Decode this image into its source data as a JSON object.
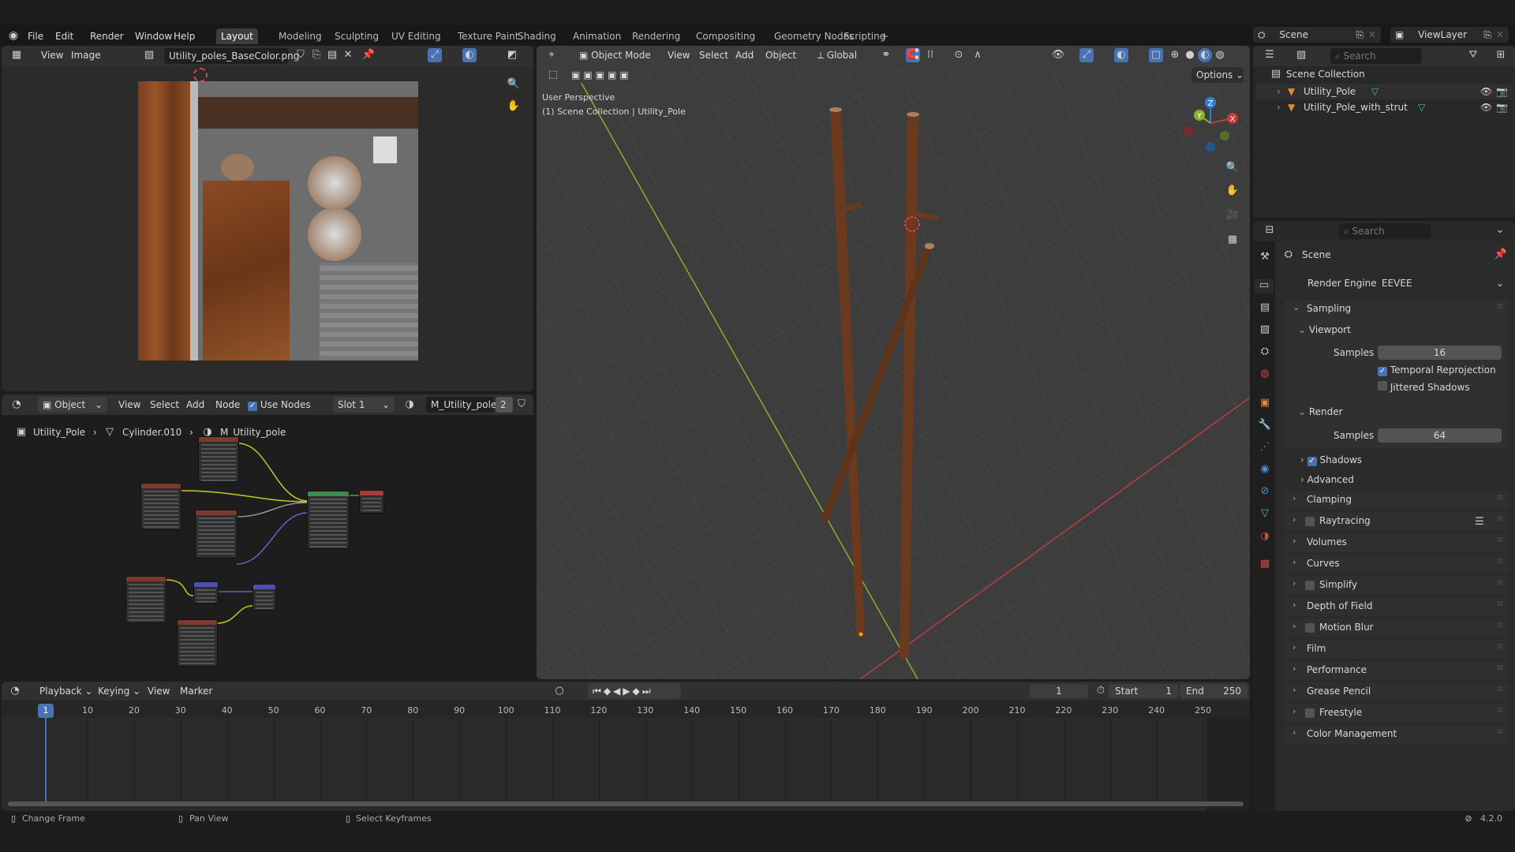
{
  "topbar": {
    "menus": [
      "File",
      "Edit",
      "Render",
      "Window",
      "Help"
    ],
    "workspaces": [
      "Layout",
      "Modeling",
      "Sculpting",
      "UV Editing",
      "Texture Paint",
      "Shading",
      "Animation",
      "Rendering",
      "Compositing",
      "Geometry Nodes",
      "Scripting"
    ],
    "active_workspace": "Layout",
    "add_tab": "+",
    "scene": "Scene",
    "view_layer": "ViewLayer"
  },
  "image_editor": {
    "menus": [
      "View",
      "Image"
    ],
    "image_name": "Utility_poles_BaseColor.png"
  },
  "node_editor": {
    "type": "Object",
    "menus": [
      "View",
      "Select",
      "Add",
      "Node"
    ],
    "use_nodes_label": "Use Nodes",
    "use_nodes": true,
    "slot": "Slot 1",
    "material": "M_Utility_pole",
    "users": "2",
    "breadcrumb": [
      "Utility_Pole",
      "Cylinder.010",
      "M_Utility_pole"
    ]
  },
  "viewport": {
    "mode": "Object Mode",
    "menus": [
      "View",
      "Select",
      "Add",
      "Object"
    ],
    "orientation": "Global",
    "options_label": "Options",
    "view_name": "User Perspective",
    "context": "(1) Scene Collection | Utility_Pole",
    "gizmo": {
      "x": "X",
      "y": "Y",
      "z": "Z"
    }
  },
  "outliner": {
    "search_placeholder": "Search",
    "root": "Scene Collection",
    "items": [
      {
        "label": "Utility_Pole"
      },
      {
        "label": "Utility_Pole_with_strut"
      }
    ]
  },
  "properties": {
    "search_placeholder": "Search",
    "context": "Scene",
    "render_engine_label": "Render Engine",
    "render_engine": "EEVEE",
    "sampling": "Sampling",
    "viewport": "Viewport",
    "viewport_samples_label": "Samples",
    "viewport_samples": "16",
    "temporal_reprojection": "Temporal Reprojection",
    "jittered_shadows": "Jittered Shadows",
    "render": "Render",
    "render_samples_label": "Samples",
    "render_samples": "64",
    "shadows": "Shadows",
    "advanced": "Advanced",
    "panels": [
      {
        "label": "Clamping",
        "checkbox": false
      },
      {
        "label": "Raytracing",
        "checkbox": true
      },
      {
        "label": "Volumes",
        "checkbox": false
      },
      {
        "label": "Curves",
        "checkbox": false
      },
      {
        "label": "Simplify",
        "checkbox": true
      },
      {
        "label": "Depth of Field",
        "checkbox": false
      },
      {
        "label": "Motion Blur",
        "checkbox": true
      },
      {
        "label": "Film",
        "checkbox": false
      },
      {
        "label": "Performance",
        "checkbox": false
      },
      {
        "label": "Grease Pencil",
        "checkbox": false
      },
      {
        "label": "Freestyle",
        "checkbox": true
      },
      {
        "label": "Color Management",
        "checkbox": false
      }
    ]
  },
  "timeline": {
    "menus": [
      "Playback",
      "Keying",
      "View",
      "Marker"
    ],
    "current_frame": "1",
    "start_label": "Start",
    "start": "1",
    "end_label": "End",
    "end": "250",
    "ticks": [
      "10",
      "20",
      "30",
      "40",
      "50",
      "60",
      "70",
      "80",
      "90",
      "100",
      "110",
      "120",
      "130",
      "140",
      "150",
      "160",
      "170",
      "180",
      "190",
      "200",
      "210",
      "220",
      "230",
      "240",
      "250"
    ],
    "playhead": "1"
  },
  "statusbar": {
    "hints": [
      "Change Frame",
      "Pan View",
      "Select Keyframes"
    ],
    "version": "4.2.0"
  },
  "colors": {
    "accent": "#4772b3",
    "x_axis": "#c4393f",
    "y_axis": "#8ab02b",
    "z_axis": "#2e7fd8"
  }
}
